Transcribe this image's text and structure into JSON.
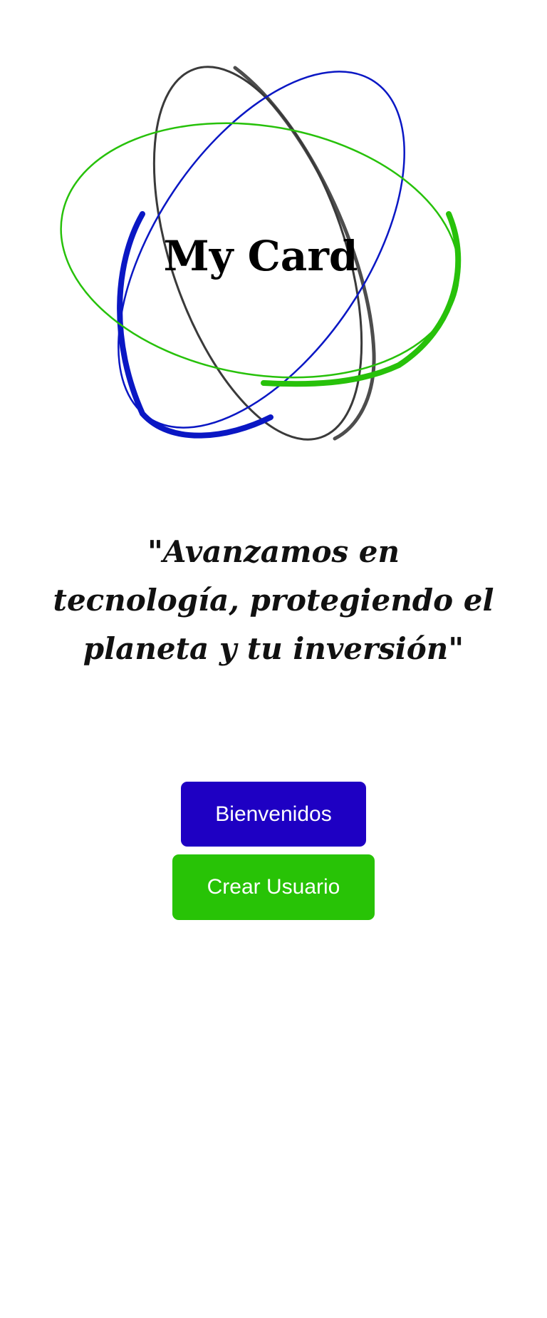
{
  "logo": {
    "title": "My Card",
    "colors": {
      "dark_ring": "#3a3a3a",
      "blue_ring": "#0a17c4",
      "green_ring": "#27c10a"
    }
  },
  "slogan": {
    "text": "\"Avanzamos en tecnología, protegiendo el planeta y tu inversión\""
  },
  "buttons": {
    "welcome": {
      "label": "Bienvenidos",
      "color": "#1e00c3"
    },
    "create_user": {
      "label": "Crear Usuario",
      "color": "#28c306"
    }
  }
}
